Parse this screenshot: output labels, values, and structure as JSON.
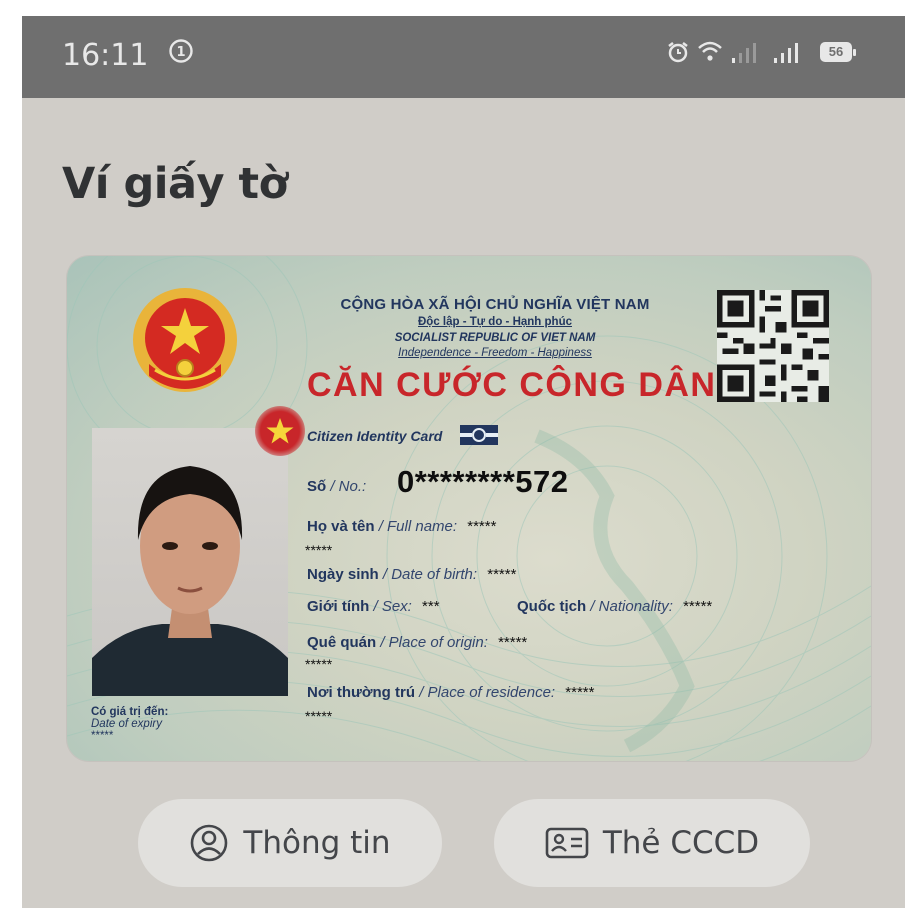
{
  "status_bar": {
    "time": "16:11",
    "notification_badge": "1",
    "battery": "56",
    "icons": [
      "alarm-icon",
      "wifi-icon",
      "signal-icon",
      "signal-icon",
      "battery-icon"
    ]
  },
  "page": {
    "title": "Ví giấy tờ"
  },
  "card": {
    "header_line1": "CỘNG HÒA XÃ HỘI CHỦ NGHĨA VIỆT NAM",
    "header_line2": "Độc lập - Tự do - Hạnh phúc",
    "header_line3": "SOCIALIST REPUBLIC OF VIET NAM",
    "header_line4": "Independence - Freedom - Happiness",
    "title": "CĂN CƯỚC CÔNG DÂN",
    "subtitle": "Citizen Identity Card",
    "number": {
      "label": "Số",
      "label_en": "/ No.:",
      "value": "0********572"
    },
    "full_name": {
      "label": "Họ và tên",
      "label_en": "/ Full name:",
      "value": "*****",
      "value_cont": "*****"
    },
    "dob": {
      "label": "Ngày sinh",
      "label_en": "/ Date of birth:",
      "value": "*****"
    },
    "sex": {
      "label": "Giới tính",
      "label_en": "/ Sex:",
      "value": "***"
    },
    "nationality": {
      "label": "Quốc tịch",
      "label_en": "/ Nationality:",
      "value": "*****"
    },
    "origin": {
      "label": "Quê quán",
      "label_en": "/ Place of origin:",
      "value": "*****",
      "value_cont": "*****"
    },
    "residence": {
      "label": "Nơi thường trú",
      "label_en": "/ Place of residence:",
      "value": "*****",
      "value_cont": "*****"
    },
    "expiry": {
      "label": "Có giá trị đến:",
      "label_en": "Date of expiry",
      "value": "*****"
    }
  },
  "buttons": {
    "info_label": "Thông tin",
    "card_label": "Thẻ CCCD"
  },
  "colors": {
    "status_bar": "#6f6f6f",
    "background": "#d0cdc8",
    "card_title_red": "#c8262a",
    "card_text_navy": "#22365e",
    "button_bg": "#e1e0dd"
  }
}
